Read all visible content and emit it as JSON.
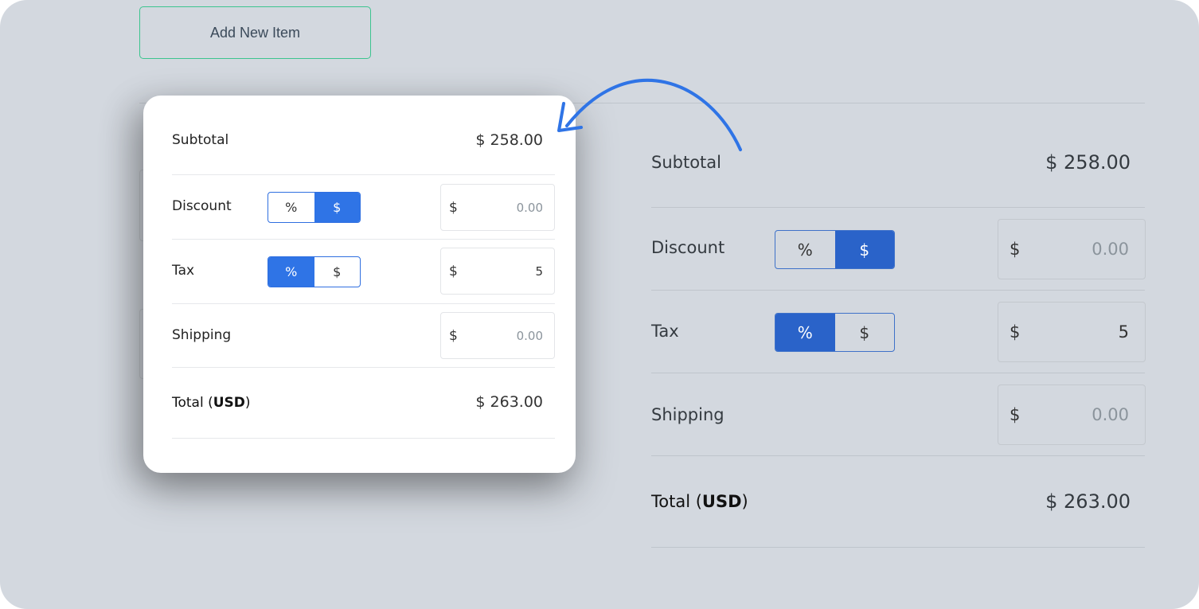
{
  "add_button": {
    "label": "Add New Item"
  },
  "summary": {
    "subtotal": {
      "label": "Subtotal",
      "value": "$ 258.00"
    },
    "discount": {
      "label": "Discount",
      "options": [
        "%",
        "$"
      ],
      "selected": "$",
      "currency": "$",
      "placeholder": "0.00"
    },
    "tax": {
      "label": "Tax",
      "options": [
        "%",
        "$"
      ],
      "selected": "%",
      "currency": "$",
      "value": "5"
    },
    "shipping": {
      "label": "Shipping",
      "currency": "$",
      "placeholder": "0.00"
    },
    "total": {
      "label": "Total (",
      "currency_code": "USD",
      "label_end": ")",
      "value": "$ 263.00"
    }
  },
  "colors": {
    "accent": "#2f74e6",
    "background": "#d3d8df",
    "button_border": "#3cc48f"
  },
  "icons": {
    "arrow": "curved-arrow-icon"
  }
}
